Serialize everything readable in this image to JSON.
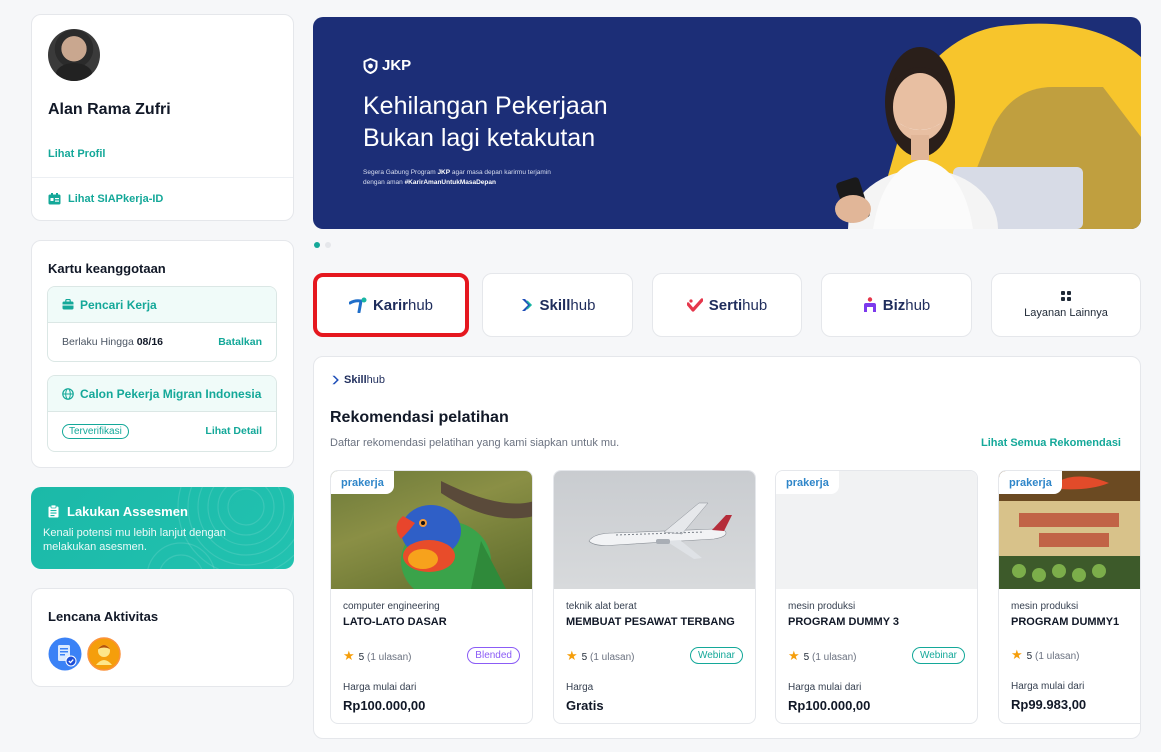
{
  "profile": {
    "name": "Alan Rama Zufri",
    "view_profile": "Lihat Profil",
    "view_siap": "Lihat SIAPkerja-ID"
  },
  "membership": {
    "title": "Kartu keanggotaan",
    "job_seeker": {
      "label": "Pencari Kerja",
      "valid_prefix": "Berlaku Hingga ",
      "valid_date": "08/16",
      "action": "Batalkan"
    },
    "migrant": {
      "label": "Calon Pekerja Migran Indonesia",
      "status": "Terverifikasi",
      "action": "Lihat Detail"
    }
  },
  "assessment": {
    "title": "Lakukan Assesmen",
    "desc": "Kenali potensi mu lebih lanjut dengan melakukan asesmen."
  },
  "badges": {
    "title": "Lencana Aktivitas"
  },
  "banner": {
    "logo": "JKP",
    "headline_1": "Kehilangan Pekerjaan",
    "headline_2": "Bukan lagi ketakutan",
    "sub_1_a": "Segera Gabung Program ",
    "sub_1_b": "JKP",
    "sub_1_c": " agar masa depan karirmu terjamin",
    "sub_2_a": "dengan aman ",
    "sub_2_b": "#KarirAmanUntukMasaDepan"
  },
  "services": [
    {
      "brand": "Karir",
      "hub": "hub"
    },
    {
      "brand": "Skill",
      "hub": "hub"
    },
    {
      "brand": "Serti",
      "hub": "hub"
    },
    {
      "brand": "Biz",
      "hub": "hub"
    },
    {
      "label": "Layanan Lainnya"
    }
  ],
  "training": {
    "brand": "Skill",
    "brand_hub": "hub",
    "title": "Rekomendasi pelatihan",
    "subtitle": "Daftar rekomendasi pelatihan yang kami siapkan untuk mu.",
    "see_all": "Lihat Semua Rekomendasi",
    "partner": "prakerja",
    "cards": [
      {
        "category": "computer engineering",
        "name": "LATO-LATO DASAR",
        "rating": "5",
        "reviews": "(1 ulasan)",
        "mode": "Blended",
        "price_label": "Harga mulai dari",
        "price": "Rp100.000,00"
      },
      {
        "category": "teknik alat berat",
        "name": "MEMBUAT PESAWAT TERBANG",
        "rating": "5",
        "reviews": "(1 ulasan)",
        "mode": "Webinar",
        "price_label": "Harga",
        "price": "Gratis"
      },
      {
        "category": "mesin produksi",
        "name": "PROGRAM DUMMY 3",
        "rating": "5",
        "reviews": "(1 ulasan)",
        "mode": "Webinar",
        "price_label": "Harga mulai dari",
        "price": "Rp100.000,00"
      },
      {
        "category": "mesin produksi",
        "name": "PROGRAM DUMMY1",
        "rating": "5",
        "reviews": "(1 ulasan)",
        "mode": "",
        "price_label": "Harga mulai dari",
        "price": "Rp99.983,00"
      }
    ]
  },
  "colors": {
    "accent": "#14a899",
    "banner_bg": "#1c2e77",
    "highlight": "#e5171f"
  }
}
